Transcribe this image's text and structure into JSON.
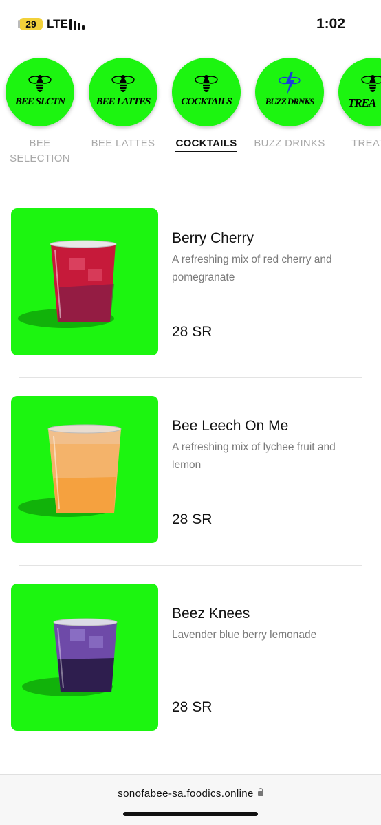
{
  "status_bar": {
    "battery": "29",
    "carrier": "LTE",
    "time": "1:02"
  },
  "categories": [
    {
      "logo_text": "BEE SLCTN",
      "label": "BEE SELECTION",
      "active": false,
      "icon": "bee-icon"
    },
    {
      "logo_text": "BEE LATTES",
      "label": "BEE LATTES",
      "active": false,
      "icon": "bee-icon"
    },
    {
      "logo_text": "COCKTAILS",
      "label": "COCKTAILS",
      "active": true,
      "icon": "bee-icon"
    },
    {
      "logo_text": "BUZZ DRNKS",
      "label": "BUZZ DRINKS",
      "active": false,
      "icon": "lightning-bee-icon"
    },
    {
      "logo_text": "TREA",
      "label": "TREAT",
      "active": false,
      "icon": "bee-icon"
    }
  ],
  "products": [
    {
      "name": "Berry Cherry",
      "description": "A refreshing mix of red cherry and pomegranate",
      "price": "28 SR",
      "drink_color": "#d8213f"
    },
    {
      "name": "Bee Leech On Me",
      "description": "A refreshing mix of lychee fruit and lemon",
      "price": "28 SR",
      "drink_color": "#f6b26b"
    },
    {
      "name": "Beez Knees",
      "description": "Lavender blue berry lemonade",
      "price": "28 SR",
      "drink_color": "#6e4aa8"
    }
  ],
  "footer": {
    "url": "sonofabee-sa.foodics.online"
  },
  "colors": {
    "brand_green": "#1cf510",
    "active_text": "#111111",
    "inactive_text": "#a8a8a8"
  }
}
